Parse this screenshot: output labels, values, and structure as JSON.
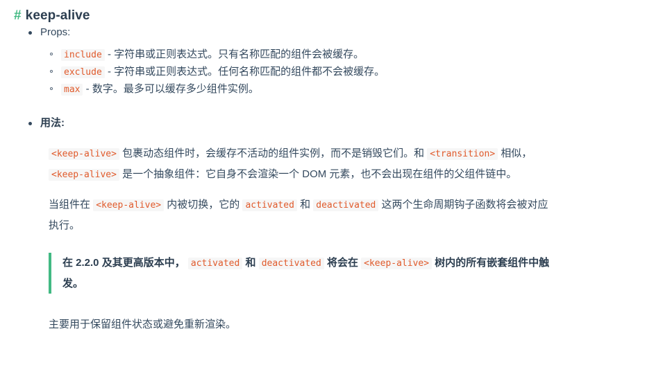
{
  "heading": {
    "hash": "#",
    "title": "keep-alive"
  },
  "colors": {
    "accent_green": "#42b983",
    "heading_text": "#2c3e50",
    "body_text": "#34495e",
    "inline_code_text": "#e05a2b",
    "inline_code_bg": "#f6f6f6"
  },
  "sections": {
    "props": {
      "label": "Props:",
      "items": [
        {
          "code": "include",
          "desc": " - 字符串或正则表达式。只有名称匹配的组件会被缓存。"
        },
        {
          "code": "exclude",
          "desc": " - 字符串或正则表达式。任何名称匹配的组件都不会被缓存。"
        },
        {
          "code": "max",
          "desc": " - 数字。最多可以缓存多少组件实例。"
        }
      ]
    },
    "usage": {
      "label": "用法:",
      "paragraph1": {
        "code1": "<keep-alive>",
        "text1": "包裹动态组件时，会缓存不活动的组件实例，而不是销毁它们。和",
        "code2": "<transition>",
        "text2": "相似，",
        "code3": "<keep-alive>",
        "text3": "是一个抽象组件：它自身不会渲染一个 DOM 元素，也不会出现在组件的父组件链中。"
      },
      "paragraph2": {
        "text1": "当组件在",
        "code1": "<keep-alive>",
        "text2": "内被切换，它的",
        "code2": "activated",
        "text3": "和",
        "code3": "deactivated",
        "text4": "这两个生命周期钩子函数将会被对应执行。"
      },
      "tip": {
        "text1": "在 2.2.0 及其更高版本中，",
        "code1": "activated",
        "text2": "和",
        "code2": "deactivated",
        "text3": "将会在",
        "code3": "<keep-alive>",
        "text4": "树内的所有嵌套组件中触发。"
      },
      "paragraph3": "主要用于保留组件状态或避免重新渲染。"
    }
  }
}
